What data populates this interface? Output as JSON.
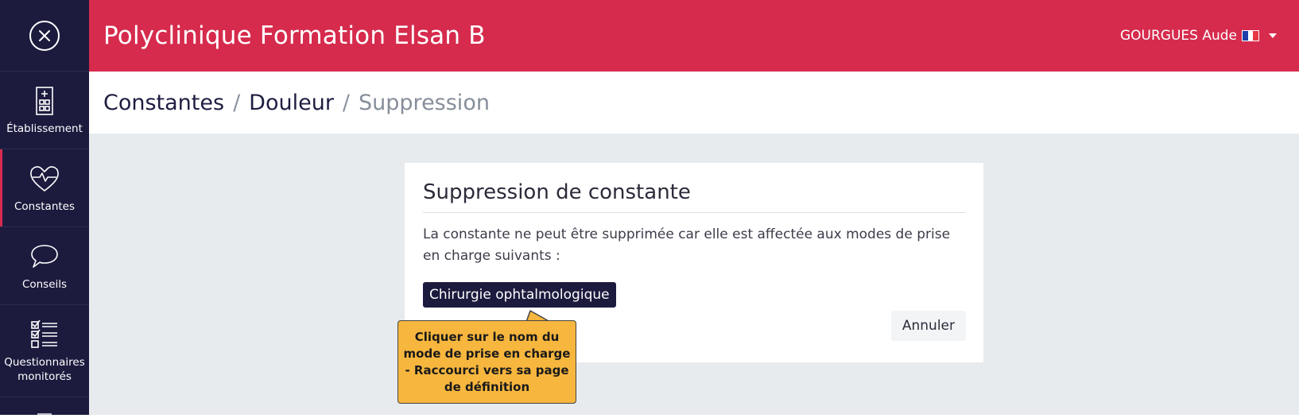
{
  "header": {
    "app_title": "Polyclinique Formation Elsan B",
    "user_name": "GOURGUES Aude",
    "flag_colors": [
      "#1f3fa8",
      "#ffffff",
      "#e63946"
    ]
  },
  "sidebar": {
    "close_icon": "close-circle-icon",
    "items": [
      {
        "label": "Établissement",
        "icon": "building-icon"
      },
      {
        "label": "Constantes",
        "icon": "heart-pulse-icon",
        "active": true
      },
      {
        "label": "Conseils",
        "icon": "speech-bubble-icon"
      },
      {
        "label": "Questionnaires monitorés",
        "icon": "checklist-icon"
      }
    ]
  },
  "breadcrumb": {
    "items": [
      "Constantes",
      "Douleur"
    ],
    "separator": "/",
    "current": "Suppression"
  },
  "card": {
    "title": "Suppression de constante",
    "message": "La constante ne peut être supprimée car elle est affectée aux modes de prise en charge suivants :",
    "modes": [
      "Chirurgie ophtalmologique"
    ],
    "cancel_label": "Annuler"
  },
  "callout": {
    "text": "Cliquer sur le nom du mode de prise en charge - Raccourci vers sa page de définition"
  },
  "colors": {
    "primary": "#d62b4d",
    "sidebar": "#1c1b3e",
    "callout": "#f7b63e",
    "content_bg": "#e8ebee"
  }
}
